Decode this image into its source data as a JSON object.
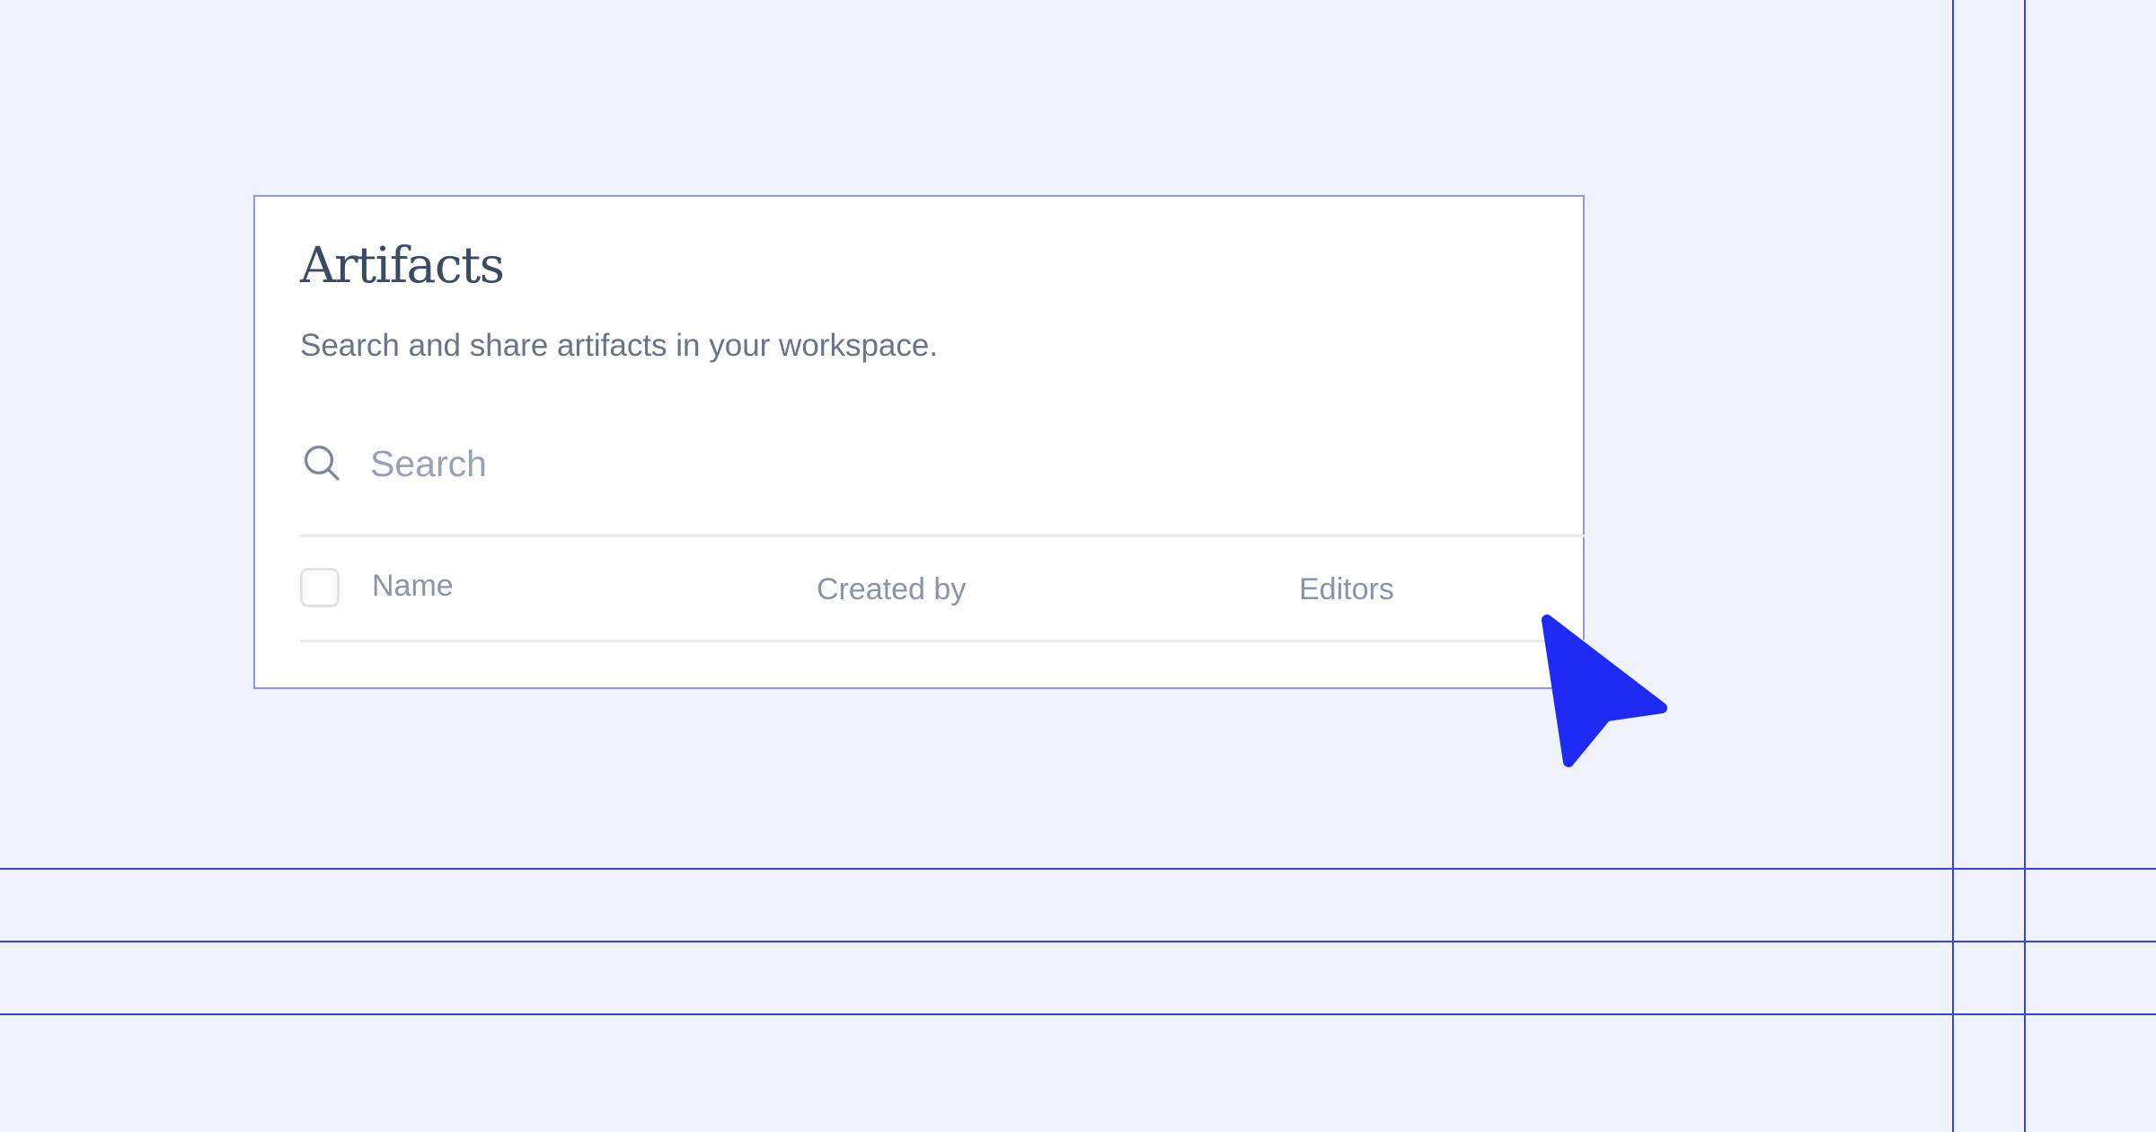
{
  "header": {
    "title": "Artifacts",
    "subtitle": "Search and share artifacts in your workspace."
  },
  "search": {
    "placeholder": "Search",
    "value": "",
    "icon": "search-icon"
  },
  "table": {
    "columns": [
      "Name",
      "Created by",
      "Editors"
    ],
    "rows": []
  },
  "colors": {
    "background": "#eff3fd",
    "guide_lines": "#3b44d6",
    "card_border": "#8f95ef",
    "cursor": "#1f2bf5",
    "title_text": "#3d4a63",
    "muted_text": "#8c95a6"
  }
}
